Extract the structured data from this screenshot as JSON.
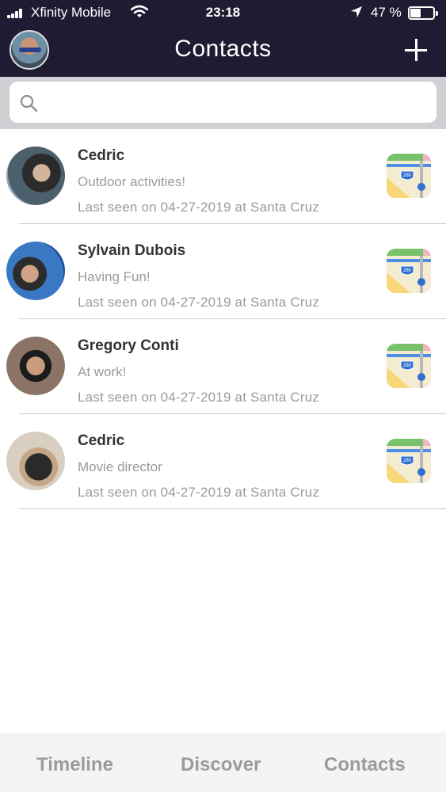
{
  "status_bar": {
    "carrier": "Xfinity Mobile",
    "time": "23:18",
    "battery_percent": "47 %",
    "battery_level": 0.47,
    "icons": [
      "signal-icon",
      "wifi-icon",
      "location-arrow-icon",
      "battery-icon"
    ]
  },
  "nav": {
    "title": "Contacts",
    "add_icon": "plus-icon"
  },
  "search": {
    "placeholder": "",
    "icon": "search-icon"
  },
  "contacts": [
    {
      "name": "Cedric",
      "status": "Outdoor activities!",
      "last_seen": "Last seen on 04-27-2019 at Santa Cruz",
      "map_badge": "280"
    },
    {
      "name": "Sylvain Dubois",
      "status": "Having Fun!",
      "last_seen": "Last seen on 04-27-2019 at Santa Cruz",
      "map_badge": "280"
    },
    {
      "name": "Gregory Conti",
      "status": "At work!",
      "last_seen": "Last seen on 04-27-2019 at Santa Cruz",
      "map_badge": "280"
    },
    {
      "name": "Cedric",
      "status": "Movie director",
      "last_seen": "Last seen on 04-27-2019 at Santa Cruz",
      "map_badge": "280"
    }
  ],
  "tabs": [
    {
      "label": "Timeline"
    },
    {
      "label": "Discover"
    },
    {
      "label": "Contacts"
    }
  ],
  "colors": {
    "header_bg": "#1f1b33",
    "search_bar_bg": "#cfcfd4",
    "tab_text": "#9b9b9b"
  }
}
